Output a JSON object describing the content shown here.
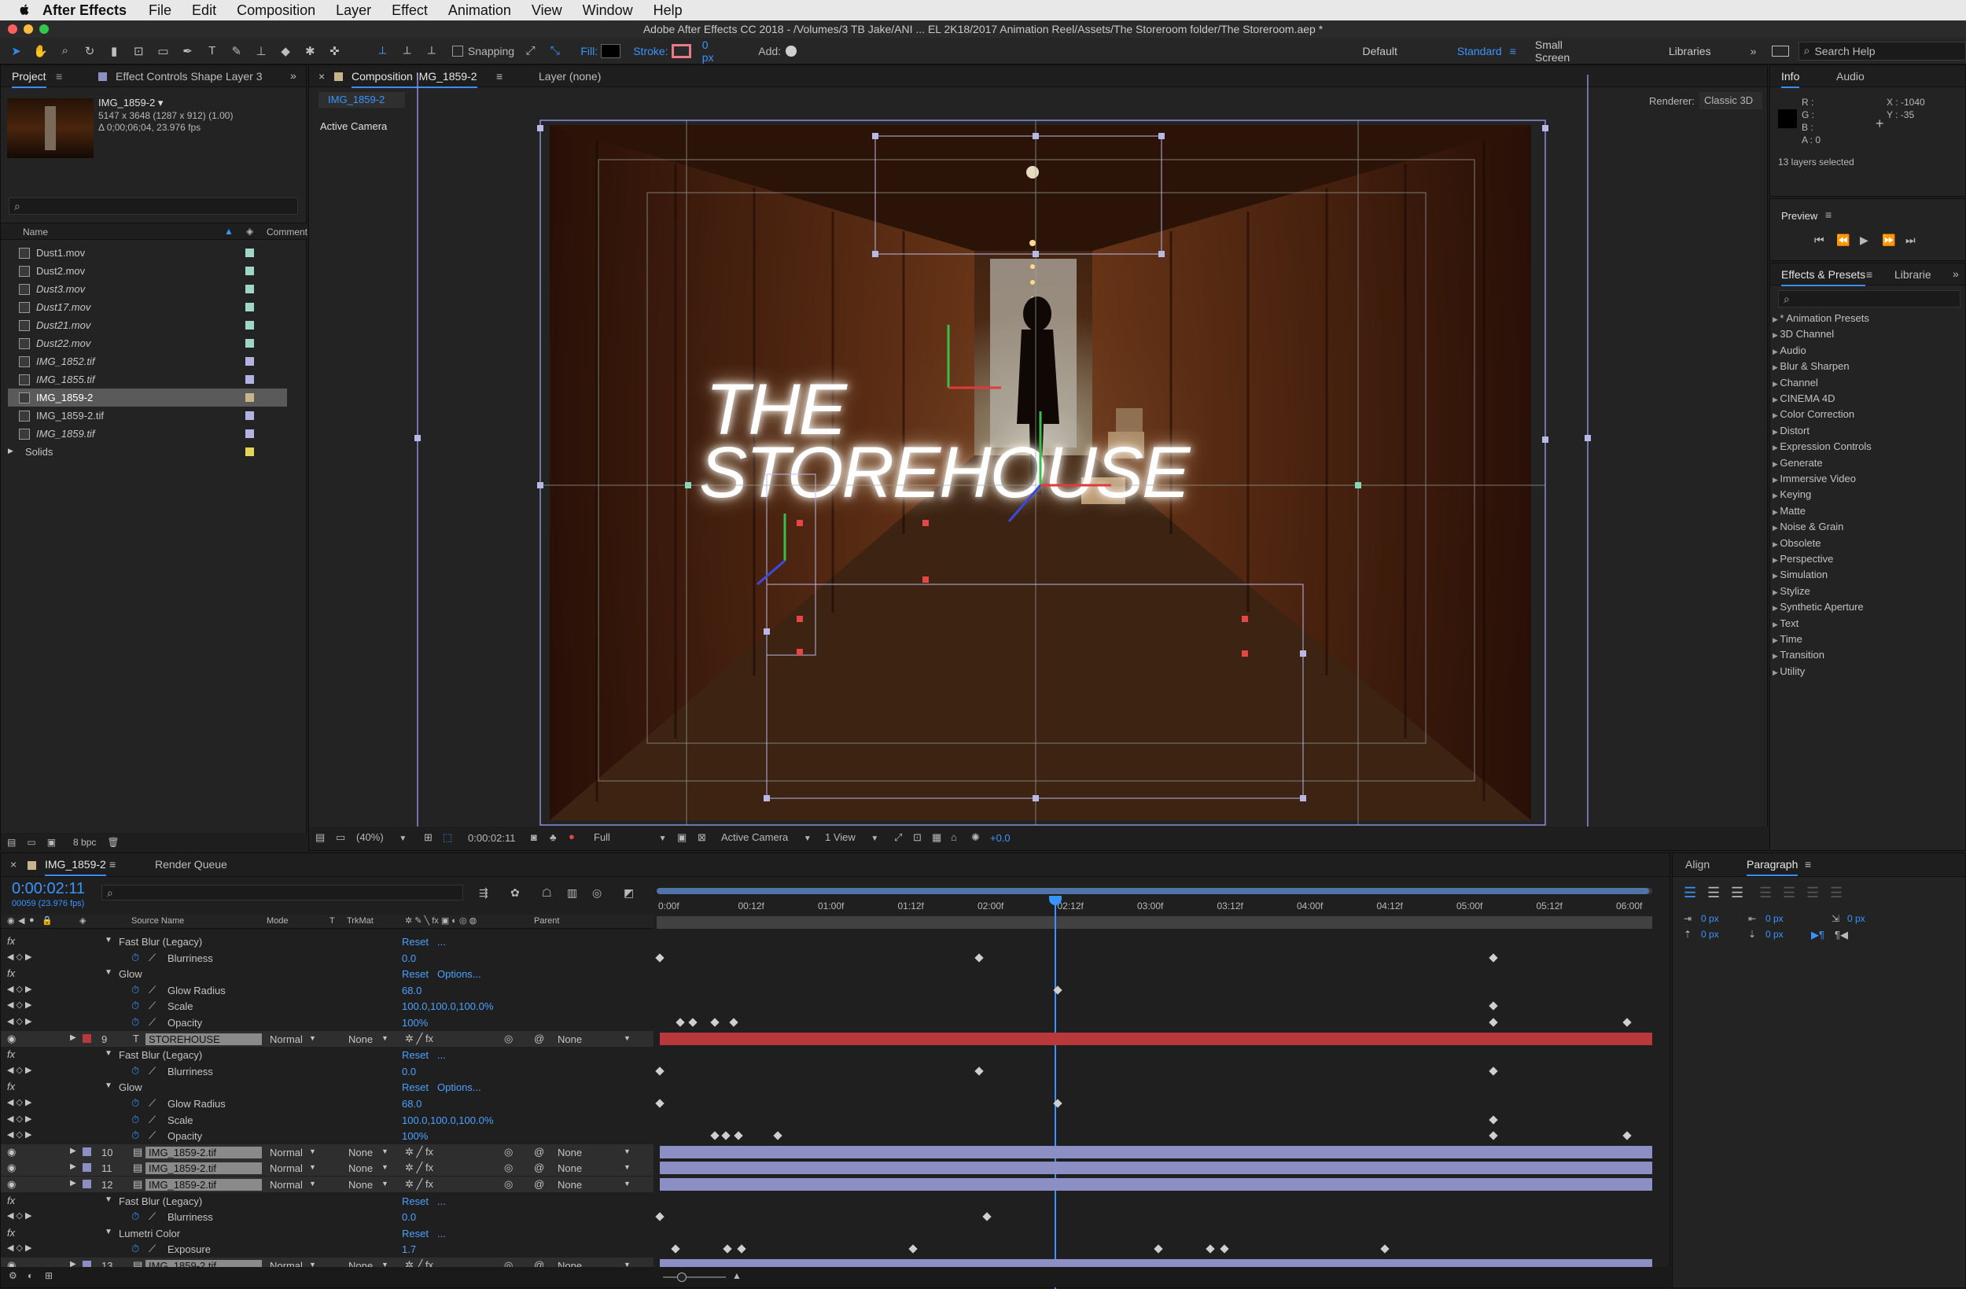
{
  "menubar": {
    "app": "After Effects",
    "items": [
      "File",
      "Edit",
      "Composition",
      "Layer",
      "Effect",
      "Animation",
      "View",
      "Window",
      "Help"
    ]
  },
  "titlebar": {
    "title": "Adobe After Effects CC 2018 - /Volumes/3 TB Jake/ANI ... EL 2K18/2017 Animation Reel/Assets/The Storeroom folder/The Storeroom.aep *"
  },
  "toolbar": {
    "snapping": "Snapping",
    "fill": "Fill:",
    "stroke": "Stroke:",
    "stroke_px": "0 px",
    "add": "Add:",
    "workspaces": [
      "Default",
      "Standard",
      "Small Screen",
      "Libraries"
    ],
    "active_workspace": "Standard",
    "search_placeholder": "Search Help"
  },
  "project": {
    "tab_project": "Project",
    "tab_effect_controls": "Effect Controls Shape Layer 3",
    "item_name": "IMG_1859-2 ▾",
    "item_dims": "5147 x 3648  (1287 x 912) (1.00)",
    "item_duration": "Δ 0;00;06;04, 23.976 fps",
    "col_name": "Name",
    "col_comment": "Comment",
    "files": [
      {
        "name": "Dust1.mov",
        "label": "#9fd6c8"
      },
      {
        "name": "Dust2.mov",
        "label": "#9fd6c8"
      },
      {
        "name": "Dust3.mov",
        "label": "#9fd6c8"
      },
      {
        "name": "Dust17.mov",
        "label": "#9fd6c8"
      },
      {
        "name": "Dust21.mov",
        "label": "#9fd6c8"
      },
      {
        "name": "Dust22.mov",
        "label": "#9fd6c8"
      },
      {
        "name": "IMG_1852.tif",
        "label": "#b4b2e0"
      },
      {
        "name": "IMG_1855.tif",
        "label": "#b4b2e0"
      },
      {
        "name": "IMG_1859-2",
        "label": "#c8b48a"
      },
      {
        "name": "IMG_1859-2.tif",
        "label": "#b4b2e0"
      },
      {
        "name": "IMG_1859.tif",
        "label": "#b4b2e0"
      },
      {
        "name": "Solids",
        "label": "#e3d45a"
      }
    ],
    "bpc": "8 bpc"
  },
  "composition": {
    "tab_label": "Composition IMG_1859-2",
    "layer_tab": "Layer (none)",
    "sub_tab": "IMG_1859-2",
    "renderer_label": "Renderer:",
    "renderer": "Classic 3D",
    "active_camera": "Active Camera",
    "title_line1": "THE",
    "title_line2": "STOREHOUSE",
    "zoom": "(40%)",
    "timecode": "0:00:02:11",
    "resolution": "Full",
    "camera_select": "Active Camera",
    "views": "1 View",
    "exposure": "+0.0"
  },
  "info": {
    "tab_info": "Info",
    "tab_audio": "Audio",
    "r": "R :",
    "g": "G :",
    "b": "B :",
    "a": "A :  0",
    "x": "X : -1040",
    "y": "Y : -35",
    "selected": "13 layers selected"
  },
  "preview": {
    "title": "Preview"
  },
  "effects": {
    "tab": "Effects & Presets",
    "tab2": "Librarie",
    "items": [
      "* Animation Presets",
      "3D Channel",
      "Audio",
      "Blur & Sharpen",
      "Channel",
      "CINEMA 4D",
      "Color Correction",
      "Distort",
      "Expression Controls",
      "Generate",
      "Immersive Video",
      "Keying",
      "Matte",
      "Noise & Grain",
      "Obsolete",
      "Perspective",
      "Simulation",
      "Stylize",
      "Synthetic Aperture",
      "Text",
      "Time",
      "Transition",
      "Utility"
    ]
  },
  "timeline": {
    "tab": "IMG_1859-2",
    "render_queue": "Render Queue",
    "timecode": "0:00:02:11",
    "frames": "00059 (23.976 fps)",
    "headers": {
      "source": "Source Name",
      "mode": "Mode",
      "t": "T",
      "trkmat": "TrkMat",
      "parent": "Parent"
    },
    "ruler": [
      "0:00f",
      "00:12f",
      "01:00f",
      "01:12f",
      "02:00f",
      "02:12f",
      "03:00f",
      "03:12f",
      "04:00f",
      "04:12f",
      "05:00f",
      "05:12f",
      "06:00f"
    ],
    "rows": [
      {
        "type": "fx",
        "name": "Fast Blur (Legacy)",
        "val": "Reset",
        "val2": "..."
      },
      {
        "type": "prop",
        "name": "Blurriness",
        "val": "0.0"
      },
      {
        "type": "fx",
        "name": "Glow",
        "val": "Reset",
        "val2": "Options..."
      },
      {
        "type": "prop",
        "name": "Glow Radius",
        "val": "68.0"
      },
      {
        "type": "prop",
        "name": "Scale",
        "val": "100.0,100.0,100.0%"
      },
      {
        "type": "prop",
        "name": "Opacity",
        "val": "100%"
      },
      {
        "type": "layer",
        "num": "9",
        "name": "STOREHOUSE",
        "mode": "Normal",
        "trk": "None",
        "parent": "None"
      },
      {
        "type": "fx",
        "name": "Fast Blur (Legacy)",
        "val": "Reset",
        "val2": "..."
      },
      {
        "type": "prop",
        "name": "Blurriness",
        "val": "0.0"
      },
      {
        "type": "fx",
        "name": "Glow",
        "val": "Reset",
        "val2": "Options..."
      },
      {
        "type": "prop",
        "name": "Glow Radius",
        "val": "68.0"
      },
      {
        "type": "prop",
        "name": "Scale",
        "val": "100.0,100.0,100.0%"
      },
      {
        "type": "prop",
        "name": "Opacity",
        "val": "100%"
      },
      {
        "type": "layer",
        "num": "10",
        "name": "IMG_1859-2.tif",
        "mode": "Normal",
        "trk": "None",
        "parent": "None"
      },
      {
        "type": "layer",
        "num": "11",
        "name": "IMG_1859-2.tif",
        "mode": "Normal",
        "trk": "None",
        "parent": "None"
      },
      {
        "type": "layer",
        "num": "12",
        "name": "IMG_1859-2.tif",
        "mode": "Normal",
        "trk": "None",
        "parent": "None"
      },
      {
        "type": "fx",
        "name": "Fast Blur (Legacy)",
        "val": "Reset",
        "val2": "..."
      },
      {
        "type": "prop",
        "name": "Blurriness",
        "val": "0.0"
      },
      {
        "type": "fx",
        "name": "Lumetri Color",
        "val": "Reset",
        "val2": "..."
      },
      {
        "type": "prop",
        "name": "Exposure",
        "val": "1.7"
      },
      {
        "type": "layer",
        "num": "13",
        "name": "IMG_1859-2.tif",
        "mode": "Normal",
        "trk": "None",
        "parent": "None"
      }
    ]
  },
  "align": {
    "tab_align": "Align",
    "tab_paragraph": "Paragraph",
    "px1": "0 px",
    "px2": "0 px",
    "px3": "0 px",
    "px4": "0 px",
    "px5": "0 px"
  },
  "colors": {
    "accent": "#3b8df0",
    "layer_red": "#b8383c",
    "layer_purple": "#8c8fc4"
  }
}
